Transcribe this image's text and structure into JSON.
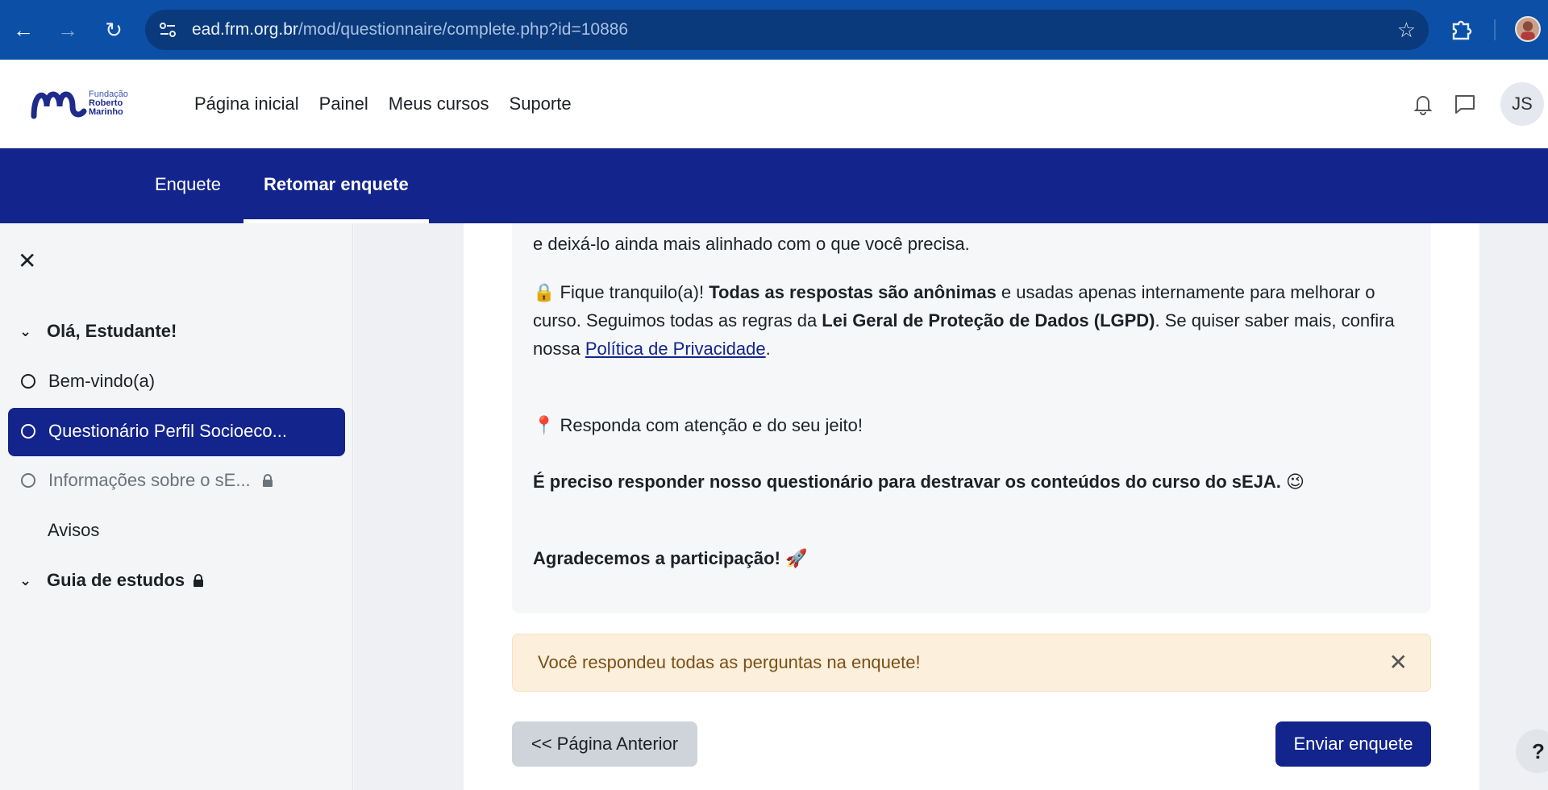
{
  "browser": {
    "url_host": "ead.frm.org.br",
    "url_path": "/mod/questionnaire/complete.php?id=10886"
  },
  "header": {
    "logo": {
      "line1": "Fundação",
      "line2": "Roberto",
      "line3": "Marinho"
    },
    "nav": [
      "Página inicial",
      "Painel",
      "Meus cursos",
      "Suporte"
    ],
    "avatar_initials": "JS"
  },
  "secondary_nav": {
    "tabs": [
      "Enquete",
      "Retomar enquete"
    ],
    "active": "Retomar enquete"
  },
  "drawer": {
    "close_glyph": "✕",
    "items": [
      {
        "label": "Olá, Estudante!",
        "type": "section"
      },
      {
        "label": "Bem-vindo(a)",
        "type": "activity"
      },
      {
        "label": "Questionário Perfil Socioeco...",
        "type": "activity",
        "active": true
      },
      {
        "label": "Informações sobre o sE...",
        "type": "activity",
        "locked": true
      },
      {
        "label": "Avisos",
        "type": "plain"
      },
      {
        "label": "Guia de estudos",
        "type": "section",
        "locked": true
      }
    ]
  },
  "content": {
    "line_intro": "e deixá-lo ainda mais alinhado com o que você precisa.",
    "privacy": {
      "emoji": "🔒",
      "t1": "Fique tranquilo(a)! ",
      "b1": "Todas as respostas são anônimas",
      "t2": " e usadas apenas internamente para melhorar o curso. Seguimos todas as regras da ",
      "b2": "Lei Geral de Proteção de Dados (LGPD)",
      "t3": ". Se quiser saber mais, confira nossa ",
      "link": "Política de Privacidade",
      "t4": "."
    },
    "respond": {
      "emoji": "📍",
      "text": "Responda com atenção e do seu jeito!"
    },
    "required": {
      "text": "É preciso responder nosso questionário para destravar os conteúdos do curso do sEJA.",
      "emoji": "😉"
    },
    "thanks": {
      "text": "Agradecemos a participação!",
      "emoji": "🚀"
    }
  },
  "alert": {
    "message": "Você respondeu todas as perguntas na enquete!",
    "close": "✕"
  },
  "buttons": {
    "prev": "<< Página Anterior",
    "send": "Enviar enquete"
  },
  "help_label": "?"
}
